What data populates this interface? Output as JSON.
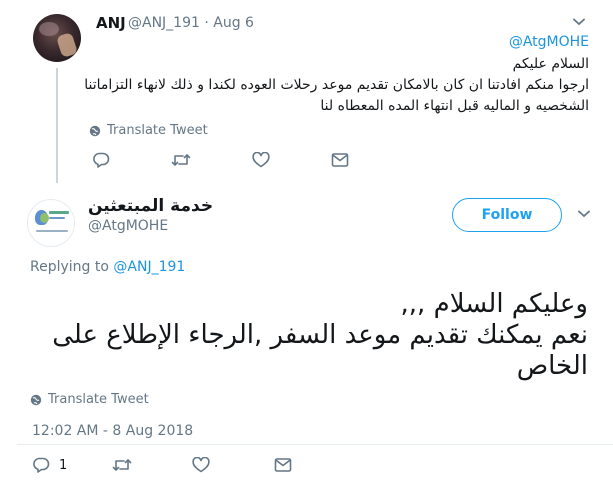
{
  "parent_tweet": {
    "name": "ANJ",
    "handle": "@ANJ_191",
    "sep": "·",
    "date": "Aug 6",
    "mention": "@AtgMOHE",
    "lines": [
      "السلام عليكم",
      "ارجوا منكم افادتنا ان كان بالامكان تقديم موعد رحلات العوده لكندا و ذلك لانهاء التزاماتنا",
      "الشخصيه و الماليه قبل انتهاء المده المعطاه لنا"
    ],
    "translate_label": "Translate Tweet",
    "icons": [
      "reply-icon",
      "retweet-icon",
      "like-icon",
      "message-icon",
      "chevron-down-icon",
      "globe-icon"
    ]
  },
  "main_tweet": {
    "name": "خدمة المبتعثين",
    "handle": "@AtgMOHE",
    "follow_label": "Follow",
    "replying_prefix": "Replying to",
    "replying_handle": "@ANJ_191",
    "lines": [
      "وعليكم السلام ,,,",
      "نعم يمكنك تقديم موعد السفر ,الرجاء الإطلاع على",
      "الخاص"
    ],
    "translate_label": "Translate Tweet",
    "timestamp": "12:02 AM - 8 Aug 2018",
    "reply_count": "1",
    "icons": [
      "reply-icon",
      "retweet-icon",
      "like-icon",
      "message-icon",
      "chevron-down-icon",
      "globe-icon"
    ]
  },
  "colors": {
    "link": "#1b95e0",
    "follow_blue": "#1da1f2",
    "muted": "#657786",
    "icon": "#657786",
    "divider": "#e6ecf0"
  }
}
